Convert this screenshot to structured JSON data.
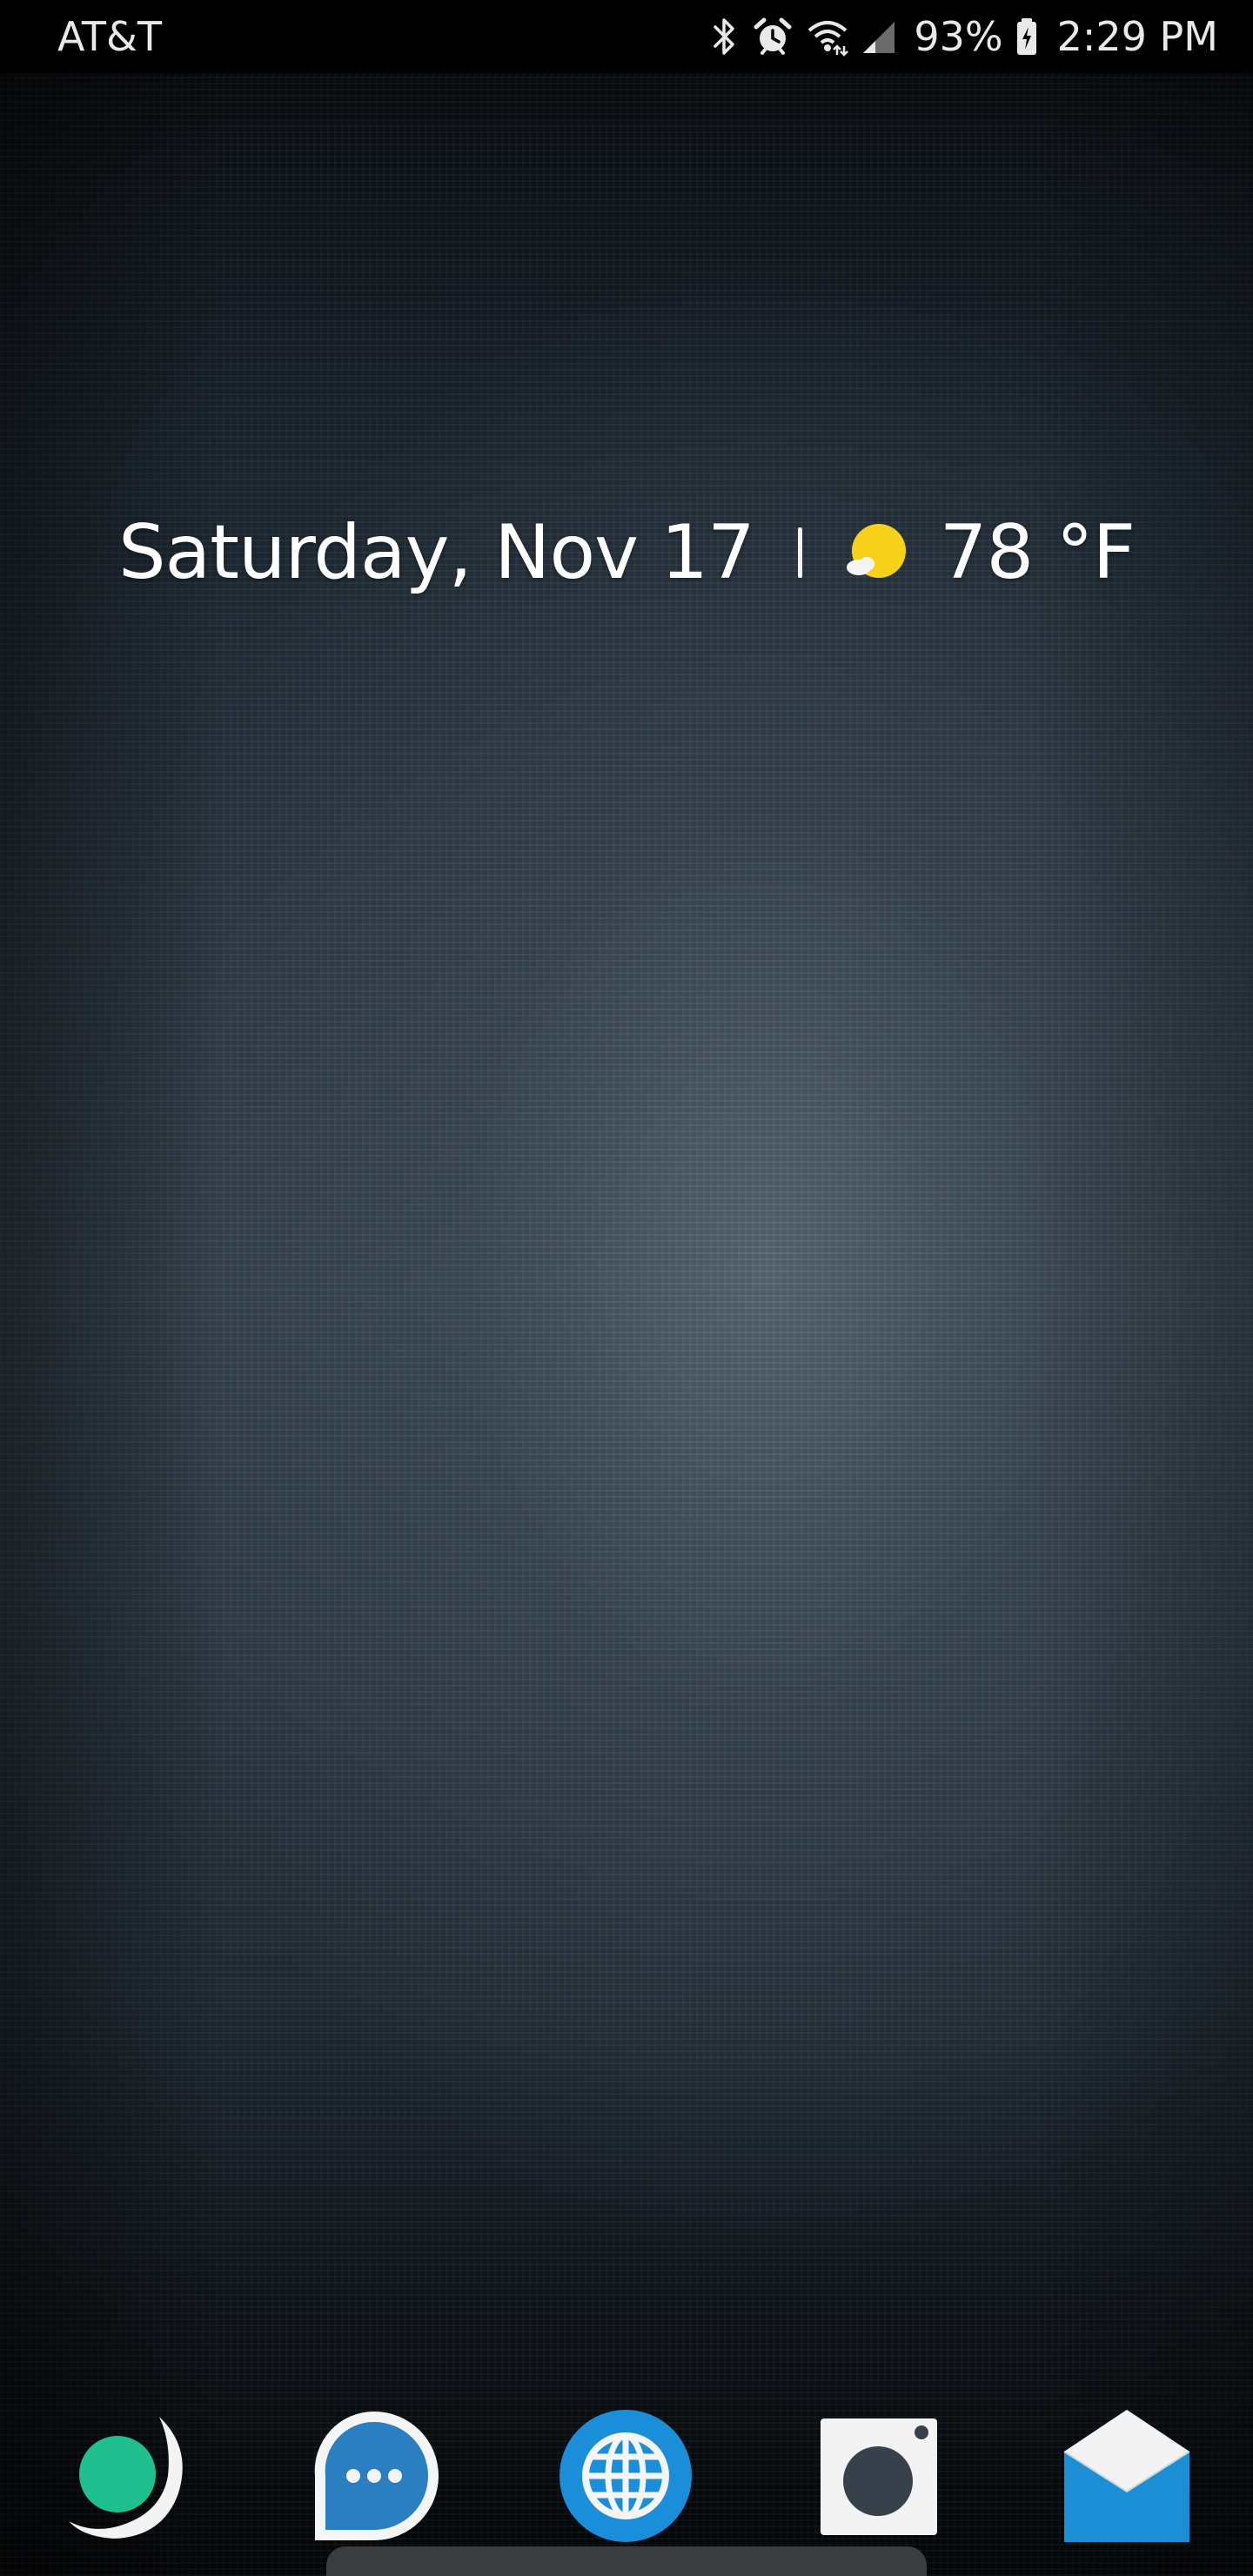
{
  "status_bar": {
    "carrier": "AT&T",
    "battery_percent": "93%",
    "time": "2:29 PM",
    "icons": [
      "bluetooth-icon",
      "alarm-icon",
      "wifi-icon",
      "signal-icon",
      "battery-charging-icon"
    ]
  },
  "glance": {
    "date": "Saturday, Nov 17",
    "temperature": "78 °F",
    "weather_icon": "sun-partly-cloudy-icon"
  },
  "dock": {
    "apps": [
      {
        "icon": "green-circle-arc-app-icon",
        "color": "#1fbf8f"
      },
      {
        "icon": "chat-bubble-dots-app-icon",
        "color": "#2a7fc1"
      },
      {
        "icon": "globe-browser-app-icon",
        "color": "#1a8ed8"
      },
      {
        "icon": "camera-app-icon",
        "color": "#37414b"
      },
      {
        "icon": "email-envelope-app-icon",
        "color": "#1b8fd6"
      }
    ]
  },
  "colors": {
    "status_bar_bg": "#000000",
    "text": "#ffffff",
    "sun": "#f7d21b"
  }
}
